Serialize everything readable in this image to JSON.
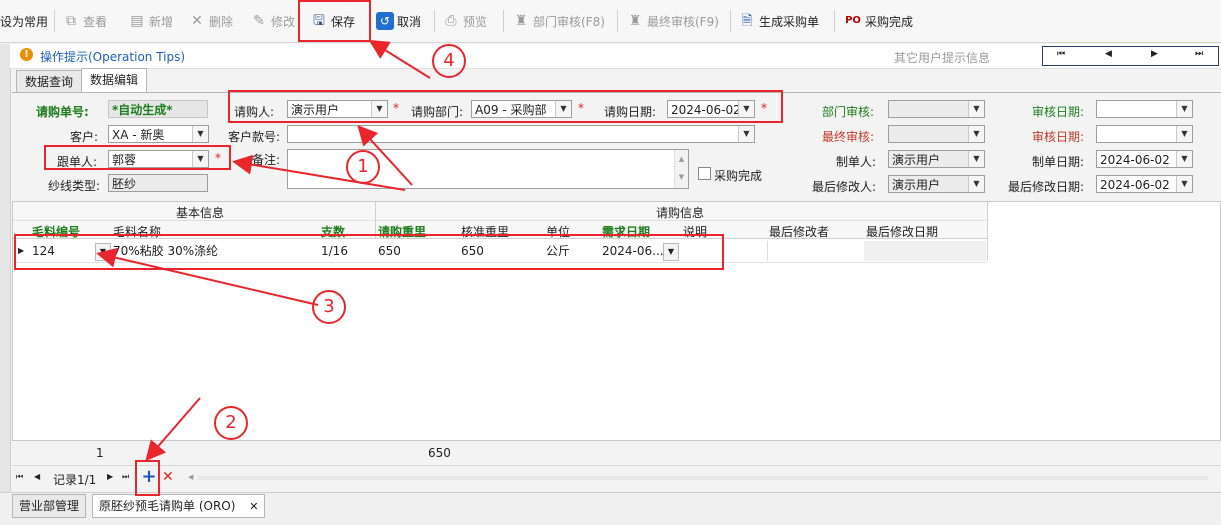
{
  "toolbar": {
    "items": [
      {
        "label": "设为常用",
        "icon": "star-icon",
        "enabled": true
      },
      {
        "label": "查看",
        "icon": "view-icon",
        "enabled": false
      },
      {
        "label": "新增",
        "icon": "new-icon",
        "enabled": false
      },
      {
        "label": "删除",
        "icon": "delete-icon",
        "enabled": false
      },
      {
        "label": "修改",
        "icon": "edit-icon",
        "enabled": false
      },
      {
        "label": "保存",
        "icon": "save-icon",
        "enabled": true
      },
      {
        "label": "取消",
        "icon": "cancel-icon",
        "enabled": true
      },
      {
        "label": "预览",
        "icon": "preview-icon",
        "enabled": false
      },
      {
        "label": "部门审核(F8)",
        "icon": "stamp-icon",
        "enabled": false
      },
      {
        "label": "最终审核(F9)",
        "icon": "stamp-icon",
        "enabled": false
      },
      {
        "label": "生成采购单",
        "icon": "document-icon",
        "enabled": true
      },
      {
        "label": "采购完成",
        "icon": "po-icon",
        "enabled": true
      }
    ]
  },
  "tips": {
    "title": "操作提示(Operation Tips)",
    "other_info": "其它用户提示信息"
  },
  "tabs": [
    "数据查询",
    "数据编辑"
  ],
  "form": {
    "order_no_label": "请购单号:",
    "order_no": "*自动生成*",
    "requester_label": "请购人:",
    "requester": "演示用户",
    "dept_label": "请购部门:",
    "dept": "A09 - 采购部",
    "date_label": "请购日期:",
    "date": "2024-06-02",
    "dept_audit_label": "部门审核:",
    "audit_date_label": "审核日期:",
    "customer_label": "客户:",
    "customer": "XA - 新奥",
    "customer_style_label": "客户款号:",
    "final_audit_label": "最终审核:",
    "final_audit_date_label": "审核日期:",
    "follower_label": "跟单人:",
    "follower": "郭蓉",
    "remark_label": "备注:",
    "purchase_done_label": "采购完成",
    "creator_label": "制单人:",
    "creator": "演示用户",
    "create_date_label": "制单日期:",
    "create_date": "2024-06-02",
    "yarn_type_label": "纱线类型:",
    "yarn_type": "胚纱",
    "last_modifier_label": "最后修改人:",
    "last_modifier": "演示用户",
    "last_modify_date_label": "最后修改日期:",
    "last_modify_date": "2024-06-02",
    "required_mark": "*"
  },
  "grid": {
    "groups": [
      "基本信息",
      "请购信息"
    ],
    "columns": [
      "毛料编号",
      "毛料名称",
      "支数",
      "请购重里",
      "核准重里",
      "单位",
      "需求日期",
      "说明",
      "最后修改者",
      "最后修改日期"
    ],
    "rows": [
      {
        "code": "124",
        "name": "70%粘胶 30%涤纶",
        "count": "1/16",
        "req_weight": "650",
        "approved_weight": "650",
        "unit": "公斤",
        "need_date": "2024-06...",
        "note": "",
        "modifier": "",
        "modify_date": ""
      }
    ],
    "footer_count": "1",
    "footer_total": "650"
  },
  "nav": {
    "record": "记录1/1"
  },
  "bottom_tabs": [
    "营业部管理",
    "原胚纱预毛请购单 (ORO)"
  ],
  "annotations": [
    "1",
    "2",
    "3",
    "4"
  ],
  "colors": {
    "annotation": "#e8262b",
    "required": "#e02020",
    "green_label": "#1e7e1e",
    "link_blue": "#1f5fbf"
  }
}
